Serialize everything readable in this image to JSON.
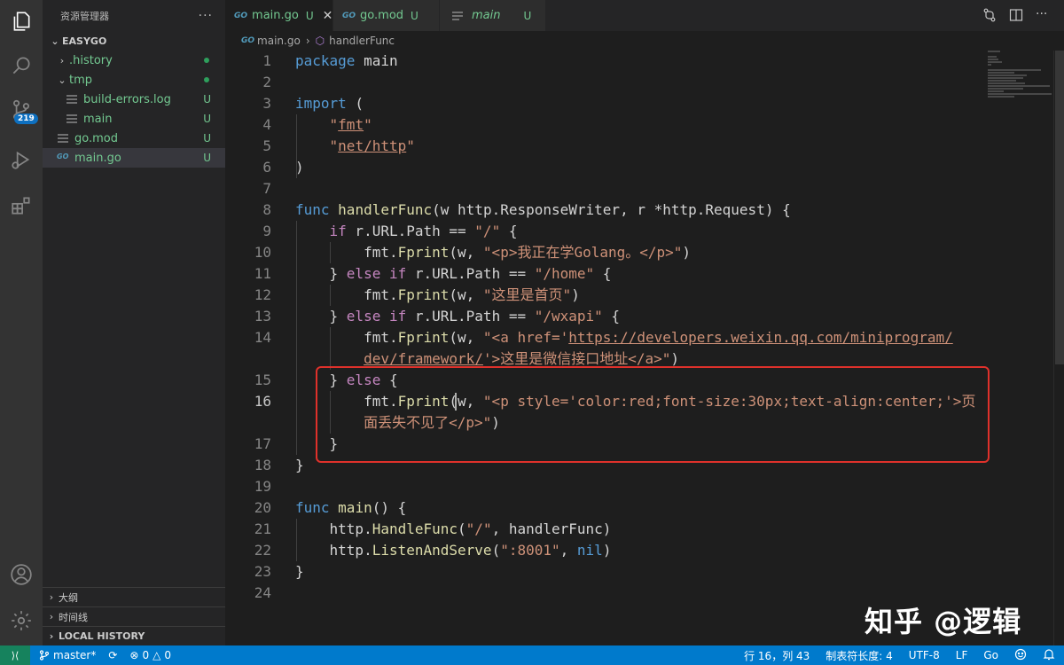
{
  "sidebar": {
    "title": "资源管理器",
    "more": "···",
    "project": "EASYGO",
    "tree": [
      {
        "name": ".history",
        "status": "•"
      },
      {
        "name": "tmp",
        "status": "•"
      },
      {
        "name": "build-errors.log",
        "status": "U"
      },
      {
        "name": "main",
        "status": "U"
      },
      {
        "name": "go.mod",
        "status": "U"
      },
      {
        "name": "main.go",
        "status": "U"
      }
    ],
    "outline": "大纲",
    "timeline": "时间线",
    "local_history": "LOCAL HISTORY"
  },
  "activity": {
    "icons": [
      "files-icon",
      "search-icon",
      "source-control-icon",
      "run-debug-icon",
      "extensions-icon",
      "account-icon",
      "settings-gear-icon"
    ],
    "scm_badge": "219"
  },
  "tabs": [
    {
      "icon": "GO",
      "label": "main.go",
      "status": "U",
      "close": "✕"
    },
    {
      "icon": "GO",
      "label": "go.mod",
      "status": "U"
    },
    {
      "label": "main",
      "status": "U"
    }
  ],
  "breadcrumb": {
    "icon": "GO",
    "file": "main.go",
    "separator": "›",
    "symbol": "handlerFunc"
  },
  "editor": {
    "line_numbers": [
      "1",
      "2",
      "3",
      "4",
      "5",
      "6",
      "7",
      "8",
      "9",
      "10",
      "11",
      "12",
      "13",
      "14",
      "15",
      "16",
      "17",
      "18",
      "19",
      "20",
      "21",
      "22",
      "23",
      "24"
    ],
    "current_line": "16"
  },
  "colors": {
    "accent": "#007acc",
    "highlight_box": "#e0312b",
    "git_untracked": "#73c991"
  },
  "watermark": "知乎 @逻辑",
  "status": {
    "remote": "⟩⟨",
    "branch": "master*",
    "sync": "⟳",
    "errors": "0",
    "warnings": "0",
    "position": "行 16，列 43",
    "indent": "制表符长度: 4",
    "encoding": "UTF-8",
    "eol": "LF",
    "language": "Go"
  }
}
